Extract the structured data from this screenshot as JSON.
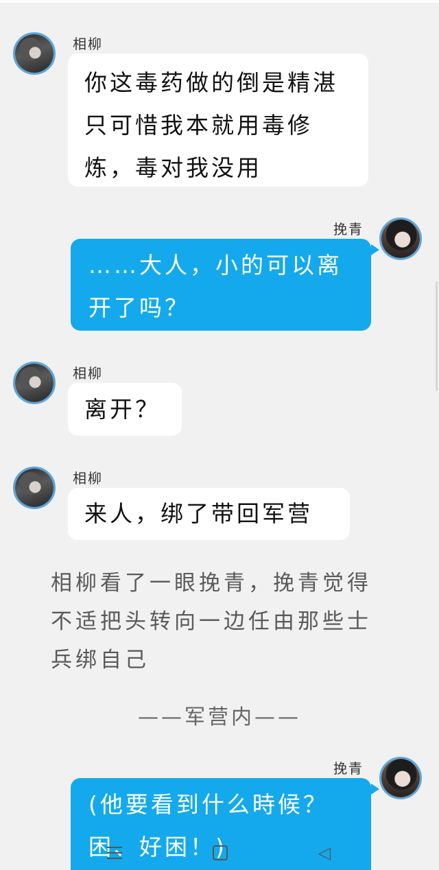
{
  "chat": {
    "messages": [
      {
        "sender": "相柳",
        "side": "left",
        "text": "你这毒药做的倒是精湛只可惜我本就用毒修炼，毒对我没用"
      },
      {
        "sender": "挽青",
        "side": "right",
        "text": "……大人，小的可以离开了吗？"
      },
      {
        "sender": "相柳",
        "side": "left",
        "text": "离开？"
      },
      {
        "sender": "相柳",
        "side": "left",
        "text": "来人，绑了带回军营"
      },
      {
        "sender": "挽青",
        "side": "right",
        "text": "(他要看到什么時候？困、好困！)"
      }
    ],
    "narration": "相柳看了一眼挽青，挽青觉得不适把头转向一边任由那些士兵绑自己",
    "scene_marker": "——军营内——"
  },
  "icons": {
    "nav": [
      "menu-icon",
      "home-icon",
      "back-icon"
    ]
  },
  "colors": {
    "background": "#f1f1f1",
    "bubble_left": "#ffffff",
    "bubble_right": "#14a9ec",
    "avatar_ring": "#5aa6de"
  }
}
